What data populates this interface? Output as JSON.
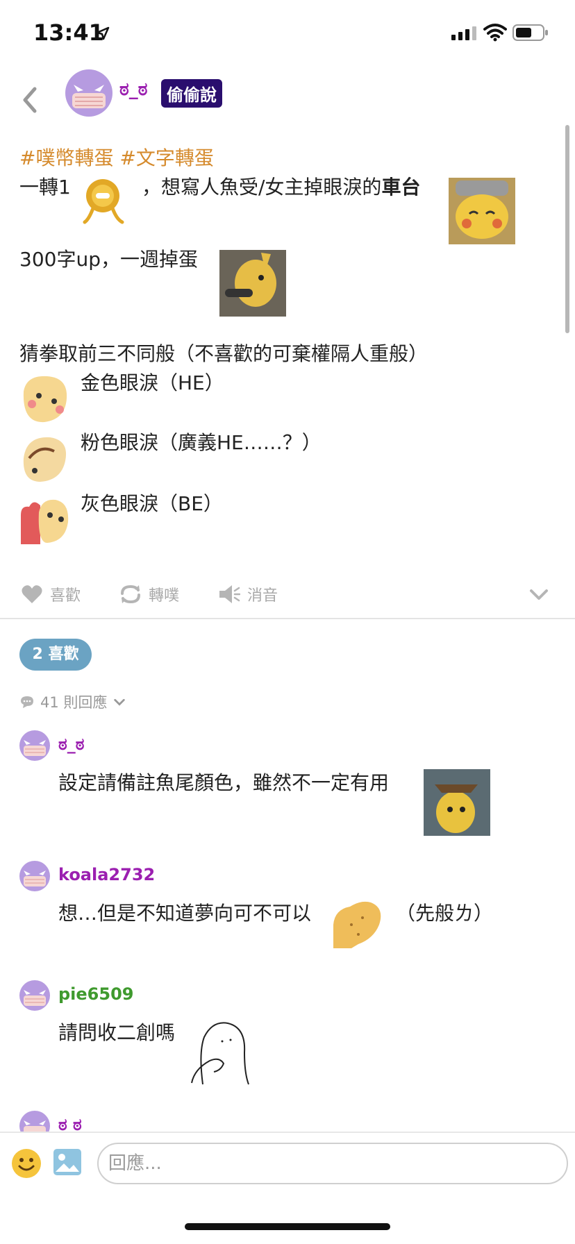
{
  "status": {
    "time": "13:41"
  },
  "header": {
    "author": "ಠ_ಠ",
    "badge": "偷偷說"
  },
  "post": {
    "tags": "#噗幣轉蛋 #文字轉蛋",
    "line1_a": "一轉1",
    "line1_b": "，想寫人魚受/女主掉眼淚的",
    "line1_bold": "車台",
    "line2": "300字up，一週掉蛋",
    "line3": "猜拳取前三不同般（不喜歡的可棄權隔人重般）",
    "options": [
      "金色眼淚（HE）",
      "粉色眼淚（廣義HE……？）",
      "灰色眼淚（BE）"
    ]
  },
  "actions": {
    "like": "喜歡",
    "replurk": "轉噗",
    "mute": "消音"
  },
  "likes": "2 喜歡",
  "replies_count": "41 則回應",
  "comments": [
    {
      "name": "ಠ_ಠ",
      "text": "設定請備註魚尾顏色，雖然不一定有用",
      "color": "#9b1fb0"
    },
    {
      "name": "koala2732",
      "text": "想…但是不知道夢向可不可以",
      "text2": "（先般ㄌ）",
      "color": "#9b1fb0"
    },
    {
      "name": "pie6509",
      "text": "請問收二創嗎",
      "color": "#3f9a2e"
    },
    {
      "name": "ಠ ಠ",
      "text": "",
      "color": "#9b1fb0"
    }
  ],
  "input": {
    "placeholder": "回應..."
  },
  "colors": {
    "tag": "#d58a2c",
    "badge_bg": "#2a0e6e",
    "likes_pill": "#6ba3c3",
    "author": "#9b1fb0",
    "pie": "#3f9a2e"
  }
}
